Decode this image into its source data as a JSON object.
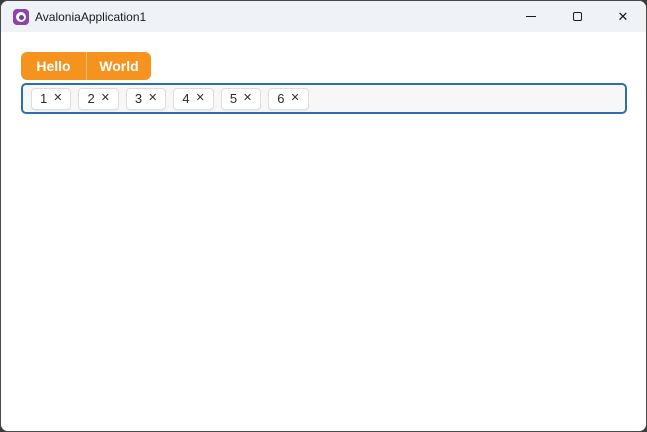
{
  "window": {
    "title": "AvaloniaApplication1",
    "backdrop_color": "#3A3A3A",
    "titlebar_bg": "#EFF2F6",
    "border_color": "#4A4A4A"
  },
  "titlebar": {
    "app_icon": "avalonia-logo",
    "app_icon_color": "#8B44AC",
    "close_glyph": "✕"
  },
  "tabs": {
    "accent_color": "#F6921E",
    "items": [
      {
        "label": "Hello"
      },
      {
        "label": "World"
      }
    ]
  },
  "chip_box": {
    "border_color": "#2D6FAE",
    "background": "#F7F7F7",
    "remove_glyph": "✕",
    "items": [
      {
        "label": "1"
      },
      {
        "label": "2"
      },
      {
        "label": "3"
      },
      {
        "label": "4"
      },
      {
        "label": "5"
      },
      {
        "label": "6"
      }
    ]
  }
}
